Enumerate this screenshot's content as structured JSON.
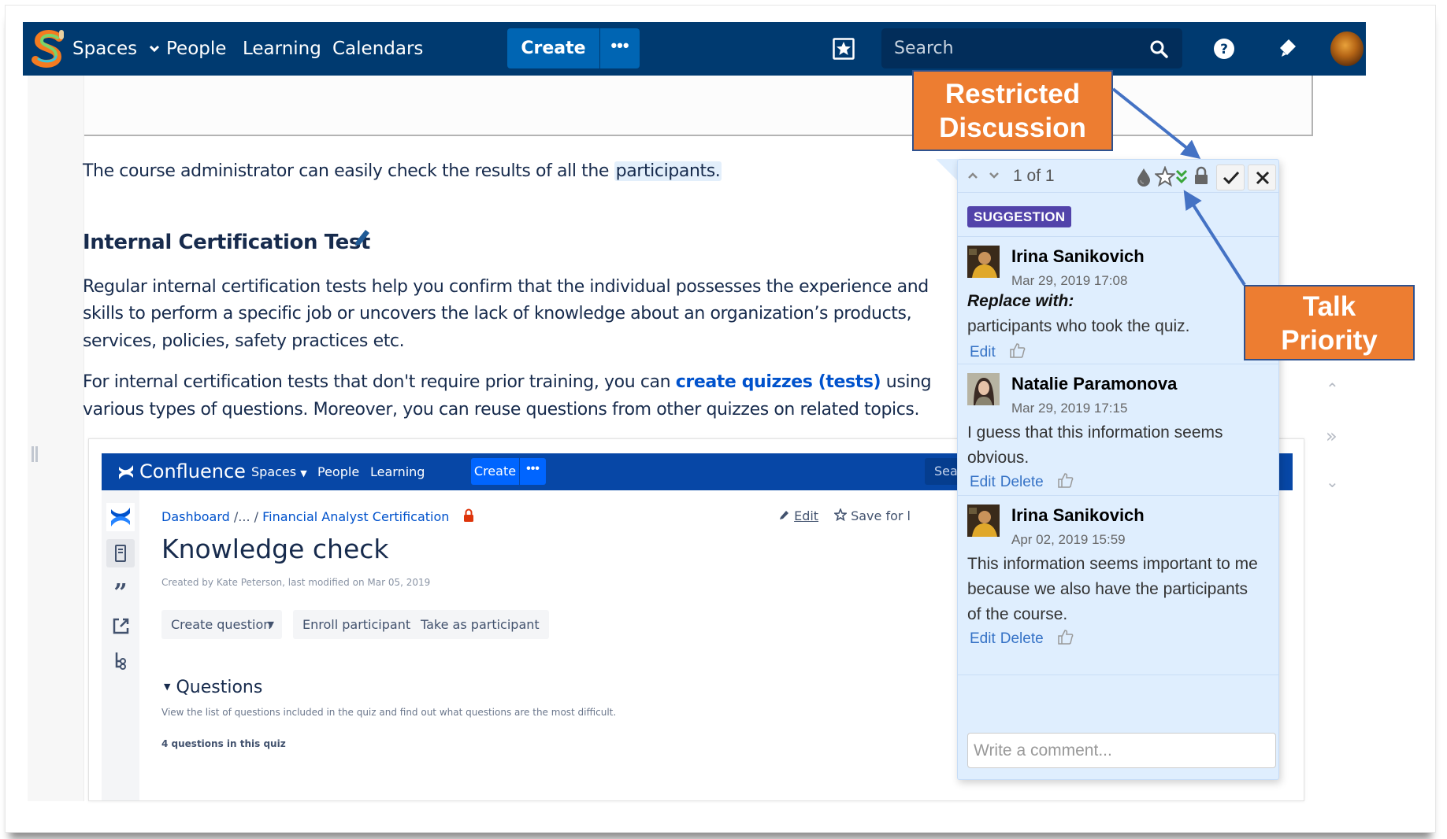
{
  "topnav": {
    "logo": "sketchy-s-logo",
    "items": [
      {
        "label": "Spaces",
        "has_dropdown": true
      },
      {
        "label": "People"
      },
      {
        "label": "Learning"
      },
      {
        "label": "Calendars"
      }
    ],
    "create_label": "Create",
    "more_label": "•••",
    "search_placeholder": "Search",
    "icons": [
      "starred-icon",
      "search-icon",
      "help-icon",
      "notifications-icon",
      "user-avatar"
    ]
  },
  "document": {
    "intro_before": "The course administrator can easily check the results of all the ",
    "intro_highlight": "participants.",
    "heading": "Internal Certification Test",
    "para1_lines": [
      "Regular internal certification tests help you confirm that the individual possesses the experience and",
      "skills to perform a specific job or uncovers the lack of knowledge about an organization’s products,",
      "services, policies, safety practices etc."
    ],
    "para2_line1_before": "For internal certification tests that don't require prior training, you can ",
    "para2_link": "create quizzes (tests)",
    "para2_line1_after": " using",
    "para2_line2": "various types of questions. Moreover, you can reuse questions from other quizzes on related topics."
  },
  "embedded": {
    "brand": "Confluence",
    "nav_items": [
      "Spaces",
      "People",
      "Learning"
    ],
    "create_label": "Create",
    "more_label": "•••",
    "search_label": "Sear",
    "breadcrumb": [
      "Dashboard",
      "/...",
      "/",
      "Financial Analyst Certification"
    ],
    "edit_label": "Edit",
    "save_label": "Save for l",
    "title": "Knowledge check",
    "byline": "Created by Kate Peterson, last modified on Mar 05, 2019",
    "buttons": [
      "Create question",
      "Enroll participants",
      "Take as participant"
    ],
    "section_title": "Questions",
    "section_desc": "View the list of questions included in the quiz and find out what questions are the most difficult.",
    "question_count": "4 questions in this quiz"
  },
  "comment_panel": {
    "position_label": "1 of 1",
    "badge": "SUGGESTION",
    "comments": [
      {
        "author": "Irina Sanikovich",
        "date": "Mar 29, 2019 17:08",
        "prefix": "Replace with:",
        "body": "participants who took the quiz.",
        "actions": [
          "Edit"
        ]
      },
      {
        "author": "Natalie Paramonova",
        "date": "Mar 29, 2019 17:15",
        "body": "I guess that this information seems obvious.",
        "actions": [
          "Edit",
          "Delete"
        ]
      },
      {
        "author": "Irina Sanikovich",
        "date": "Apr 02, 2019 15:59",
        "body": "This information seems important to me because we also have the participants of the course.",
        "actions": [
          "Edit",
          "Delete"
        ]
      }
    ],
    "input_placeholder": "Write a comment..."
  },
  "callouts": {
    "restricted": [
      "Restricted",
      "Discussion"
    ],
    "priority": [
      "Talk",
      "Priority"
    ]
  },
  "colors": {
    "nav_bg": "#003a70",
    "create_bg": "#0065b3",
    "panel_bg": "#dfeefe",
    "badge_bg": "#5243aa",
    "callout_bg": "#ed7d31",
    "arrow": "#4472c4",
    "priority_green": "#3aa63a"
  }
}
